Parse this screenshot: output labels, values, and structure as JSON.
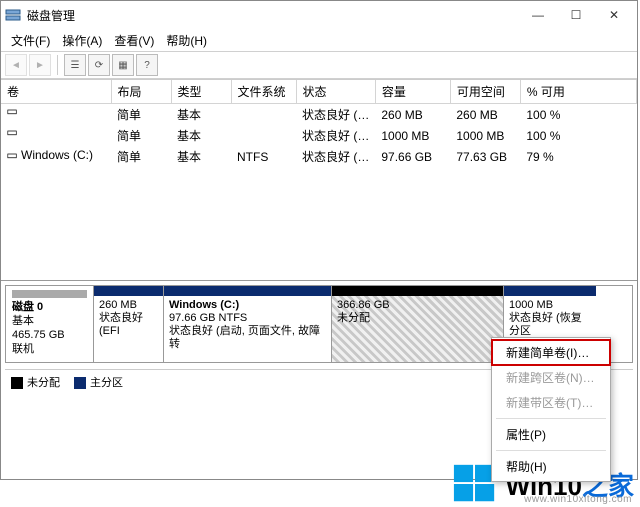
{
  "title": "磁盘管理",
  "menu": {
    "file": "文件(F)",
    "action": "操作(A)",
    "view": "查看(V)",
    "help": "帮助(H)"
  },
  "columns": {
    "volume": "卷",
    "layout": "布局",
    "type": "类型",
    "fs": "文件系统",
    "status": "状态",
    "capacity": "容量",
    "free": "可用空间",
    "pctfree": "% 可用"
  },
  "volumes": [
    {
      "name": "",
      "layout": "简单",
      "type": "基本",
      "fs": "",
      "status": "状态良好 (…",
      "capacity": "260 MB",
      "free": "260 MB",
      "pct": "100 %"
    },
    {
      "name": "",
      "layout": "简单",
      "type": "基本",
      "fs": "",
      "status": "状态良好 (…",
      "capacity": "1000 MB",
      "free": "1000 MB",
      "pct": "100 %"
    },
    {
      "name": "Windows (C:)",
      "layout": "简单",
      "type": "基本",
      "fs": "NTFS",
      "status": "状态良好 (…",
      "capacity": "97.66 GB",
      "free": "77.63 GB",
      "pct": "79 %"
    }
  ],
  "disk": {
    "hdr": {
      "label": "磁盘 0",
      "type": "基本",
      "size": "465.75 GB",
      "status": "联机"
    },
    "parts": [
      {
        "kind": "primary",
        "width": 70,
        "line1": "",
        "line2": "260 MB",
        "line3": "状态良好 (EFI"
      },
      {
        "kind": "primary",
        "width": 168,
        "line1": "Windows  (C:)",
        "line2": "97.66 GB NTFS",
        "line3": "状态良好 (启动, 页面文件, 故障转"
      },
      {
        "kind": "unalloc",
        "width": 172,
        "line1": "",
        "line2": "366.86 GB",
        "line3": "未分配",
        "hatched": true
      },
      {
        "kind": "primary",
        "width": 92,
        "line1": "",
        "line2": "1000 MB",
        "line3": "状态良好 (恢复分区"
      }
    ]
  },
  "legend": {
    "unalloc": "未分配",
    "primary": "主分区"
  },
  "ctx": {
    "new_simple": "新建简单卷(I)…",
    "new_span": "新建跨区卷(N)…",
    "new_stripe": "新建带区卷(T)…",
    "props": "属性(P)",
    "help": "帮助(H)"
  },
  "watermark": {
    "text_a": "Win10",
    "text_b": "之家",
    "url": "www.win10xitong.com"
  }
}
